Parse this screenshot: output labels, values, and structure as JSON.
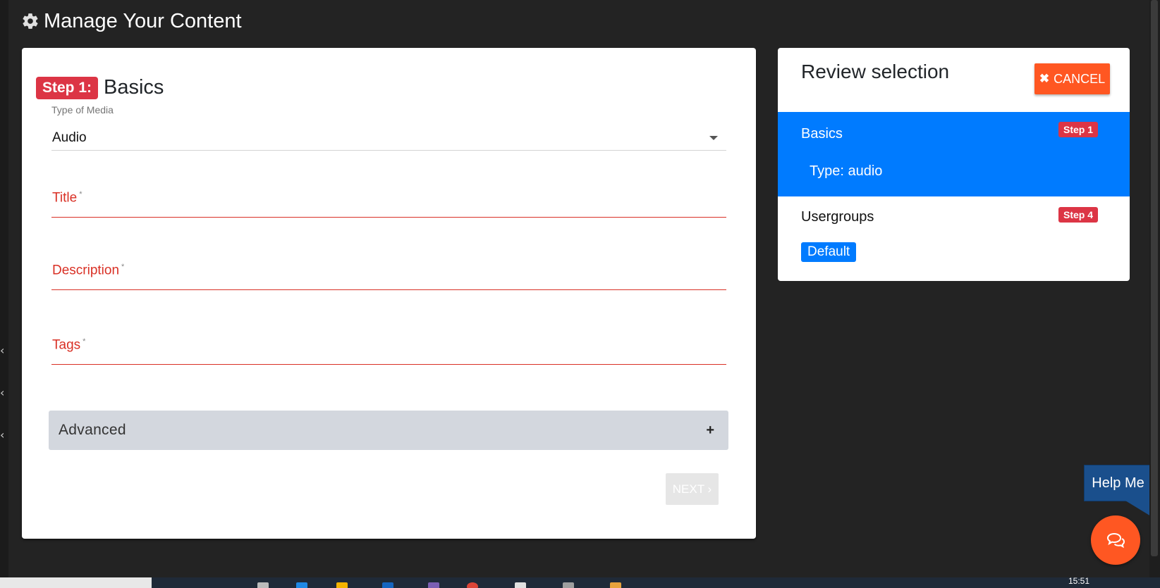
{
  "header": {
    "title": "Manage Your Content"
  },
  "form": {
    "step_badge": "Step 1:",
    "step_name": "Basics",
    "media_label": "Type of Media",
    "media_value": "Audio",
    "fields": {
      "title": "Title",
      "description": "Description",
      "tags": "Tags",
      "required_mark": "*"
    },
    "advanced_label": "Advanced",
    "next_label": "NEXT ›"
  },
  "review": {
    "title": "Review selection",
    "cancel_label": "CANCEL",
    "basics": {
      "title": "Basics",
      "step": "Step 1",
      "type_line": "Type: audio"
    },
    "usergroups": {
      "title": "Usergroups",
      "step": "Step 4",
      "group": "Default"
    }
  },
  "help": {
    "label": "Help Me"
  },
  "taskbar": {
    "clock": "15:51"
  },
  "colors": {
    "primary": "#007bff",
    "danger": "#dc3545",
    "accent": "#ff5722",
    "required": "#d93025",
    "background": "#232323"
  }
}
